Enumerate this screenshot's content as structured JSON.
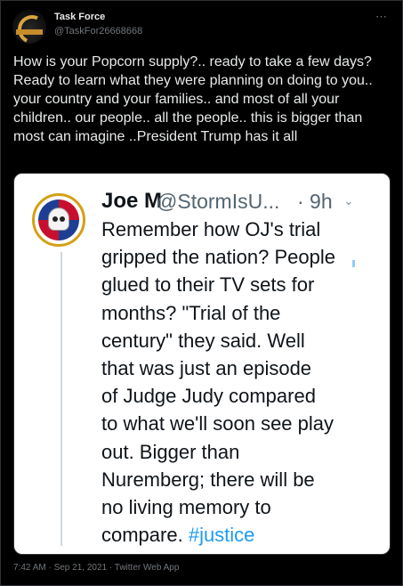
{
  "tweet": {
    "name": "Task Force",
    "handle": "@TaskFor26668668",
    "more_icon": "⋯",
    "text": "How is your Popcorn supply?.. ready to take a few days?  Ready to learn what they were planning on doing to you.. your country and your families.. and most of all your children.. our people.. all the people.. this is bigger than most can imagine ..President Trump has it all",
    "meta": "7:42 AM · Sep 21, 2021 · Twitter Web App"
  },
  "embedded": {
    "name": "Joe M",
    "handle": "@StormIsU...",
    "time": "· 9h",
    "chevron": "⌄",
    "body": "Remember how OJ's trial\ngripped the nation? People\nglued to their TV sets for\nmonths? \"Trial of the\ncentury\" they said. Well\nthat was just an episode\nof Judge Judy compared\nto what we'll soon see play\nout. Bigger than\nNuremberg; there will be\nno living memory to\ncompare. ",
    "hashtag": "#justice"
  }
}
